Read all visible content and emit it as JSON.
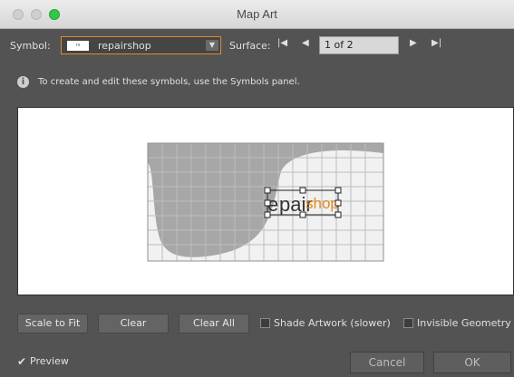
{
  "window": {
    "title": "Map Art"
  },
  "toolbar": {
    "symbol_label": "Symbol:",
    "symbol_value": "repairshop",
    "surface_label": "Surface:",
    "surface_value": "1 of 2",
    "first_glyph": "|◀",
    "prev_glyph": "◀",
    "next_glyph": "▶",
    "last_glyph": "▶|"
  },
  "info": {
    "icon": "info-icon",
    "text": "To create and edit these symbols, use the Symbols panel."
  },
  "preview": {
    "artwork_parts": [
      "e",
      "pair",
      "shop"
    ],
    "accent_color": "#e58b1f"
  },
  "buttons": {
    "scale_to_fit": "Scale to Fit",
    "clear": "Clear",
    "clear_all": "Clear All",
    "shade_artwork": "Shade Artwork (slower)",
    "invisible_geometry": "Invisible Geometry"
  },
  "footer": {
    "preview_label": "Preview",
    "preview_checked": true,
    "cancel": "Cancel",
    "ok": "OK"
  }
}
